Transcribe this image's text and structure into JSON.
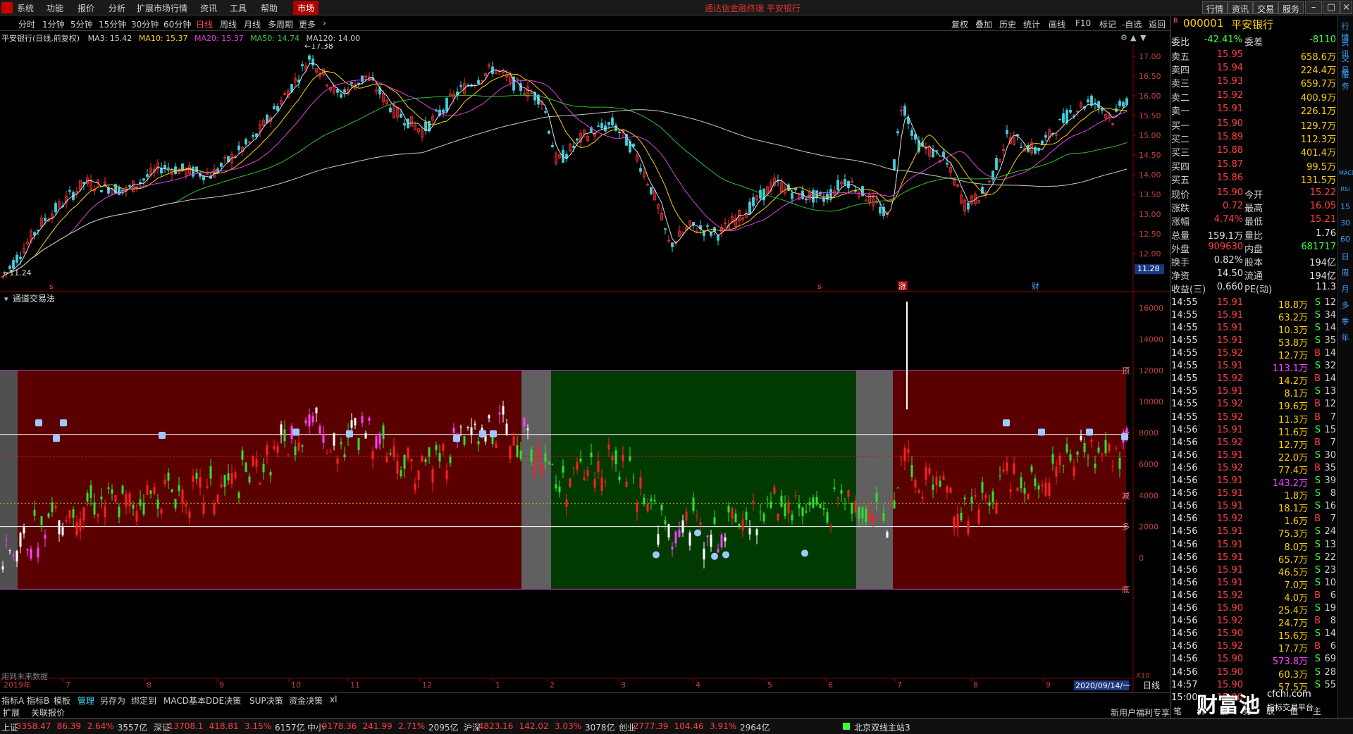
{
  "menu": {
    "items": [
      "系统",
      "功能",
      "报价",
      "分析",
      "扩展市场行情",
      "资讯",
      "工具",
      "帮助"
    ],
    "market": "市场",
    "title": "通达信金融终端  平安银行",
    "buttons": [
      "行情",
      "资讯",
      "交易",
      "服务"
    ]
  },
  "periods": {
    "items": [
      "分时",
      "1分钟",
      "5分钟",
      "15分钟",
      "30分钟",
      "60分钟",
      "日线",
      "周线",
      "月线",
      "多周期",
      "更多"
    ],
    "active": "日线",
    "tools": [
      "复权",
      "叠加",
      "历史",
      "统计",
      "画线",
      "F10",
      "标记",
      "-自选",
      "返回"
    ]
  },
  "info": {
    "stock": "平安银行(日线,前复权)",
    "ma3": "MA3: 15.42",
    "ma10": "MA10: 15.37",
    "ma20": "MA20: 15.37",
    "ma50": "MA50: 14.74",
    "ma120": "MA120: 14.00"
  },
  "chart_data": {
    "type": "candlestick",
    "price_axis": [
      17.0,
      16.5,
      16.0,
      15.5,
      15.0,
      14.5,
      14.0,
      13.5,
      13.0,
      12.5,
      12.0
    ],
    "annotations": {
      "high": "17.38",
      "low": "11.24",
      "current": "11.28",
      "period": "日线"
    },
    "markers": [
      "s",
      "s",
      "涨",
      "财"
    ],
    "months": [
      "2019年",
      "7",
      "8",
      "9",
      "10",
      "11",
      "12",
      "1",
      "2",
      "3",
      "4",
      "5",
      "6",
      "7",
      "8",
      "9"
    ],
    "date_label": "2020/09/14/一",
    "x10": "X10",
    "indicator": {
      "name": "通道交易法",
      "axis": [
        16000,
        14000,
        12000,
        10000,
        8000,
        6000,
        4000,
        2000,
        0
      ],
      "labels": [
        "顶",
        "空",
        "减",
        "多",
        "底"
      ],
      "zones": [
        "red",
        "gray",
        "green",
        "gray",
        "red"
      ],
      "note": "用到未来数据"
    }
  },
  "quote": {
    "code": "000001",
    "name": "平安银行",
    "weibi": [
      "委比",
      "-42.41%",
      "委差",
      "-8110"
    ],
    "sell": [
      [
        "卖五",
        "15.95",
        "658.6万"
      ],
      [
        "卖四",
        "15.94",
        "224.4万"
      ],
      [
        "卖三",
        "15.93",
        "659.7万"
      ],
      [
        "卖二",
        "15.92",
        "400.9万"
      ],
      [
        "卖一",
        "15.91",
        "226.1万"
      ]
    ],
    "buy": [
      [
        "买一",
        "15.90",
        "129.7万"
      ],
      [
        "买二",
        "15.89",
        "112.3万"
      ],
      [
        "买三",
        "15.88",
        "401.4万"
      ],
      [
        "买四",
        "15.87",
        "99.5万"
      ],
      [
        "买五",
        "15.86",
        "131.5万"
      ]
    ],
    "stats": [
      [
        "现价",
        "15.90",
        "今开",
        "15.22"
      ],
      [
        "涨跌",
        "0.72",
        "最高",
        "16.05"
      ],
      [
        "涨幅",
        "4.74%",
        "最低",
        "15.21"
      ],
      [
        "总量",
        "159.1万",
        "量比",
        "1.76"
      ],
      [
        "外盘",
        "909630",
        "内盘",
        "681717"
      ],
      [
        "换手",
        "0.82%",
        "股本",
        "194亿"
      ],
      [
        "净资",
        "14.50",
        "流通",
        "194亿"
      ],
      [
        "收益(三)",
        "0.660",
        "PE(动)",
        "11.3"
      ]
    ],
    "ticks": [
      [
        "14:55",
        "15.91",
        "18.8万",
        "S",
        "12"
      ],
      [
        "14:55",
        "15.91",
        "63.2万",
        "S",
        "34"
      ],
      [
        "14:55",
        "15.91",
        "10.3万",
        "S",
        "14"
      ],
      [
        "14:55",
        "15.91",
        "53.8万",
        "S",
        "35"
      ],
      [
        "14:55",
        "15.92",
        "12.7万",
        "B",
        "14"
      ],
      [
        "14:55",
        "15.91",
        "113.1万",
        "S",
        "32"
      ],
      [
        "14:55",
        "15.92",
        "14.2万",
        "B",
        "14"
      ],
      [
        "14:55",
        "15.91",
        "8.1万",
        "S",
        "13"
      ],
      [
        "14:55",
        "15.92",
        "19.6万",
        "B",
        "12"
      ],
      [
        "14:55",
        "15.92",
        "11.3万",
        "B",
        "7"
      ],
      [
        "14:56",
        "15.91",
        "11.6万",
        "S",
        "15"
      ],
      [
        "14:56",
        "15.92",
        "12.7万",
        "B",
        "7"
      ],
      [
        "14:56",
        "15.91",
        "22.0万",
        "S",
        "30"
      ],
      [
        "14:56",
        "15.92",
        "77.4万",
        "B",
        "35"
      ],
      [
        "14:56",
        "15.91",
        "143.2万",
        "S",
        "39"
      ],
      [
        "14:56",
        "15.91",
        "1.8万",
        "S",
        "8"
      ],
      [
        "14:56",
        "15.91",
        "18.1万",
        "S",
        "16"
      ],
      [
        "14:56",
        "15.92",
        "1.6万",
        "B",
        "7"
      ],
      [
        "14:56",
        "15.91",
        "75.3万",
        "S",
        "24"
      ],
      [
        "14:56",
        "15.91",
        "8.0万",
        "S",
        "13"
      ],
      [
        "14:56",
        "15.91",
        "65.7万",
        "S",
        "22"
      ],
      [
        "14:56",
        "15.91",
        "46.5万",
        "S",
        "23"
      ],
      [
        "14:56",
        "15.91",
        "7.0万",
        "S",
        "10"
      ],
      [
        "14:56",
        "15.92",
        "4.0万",
        "B",
        "6"
      ],
      [
        "14:56",
        "15.90",
        "25.4万",
        "S",
        "19"
      ],
      [
        "14:56",
        "15.92",
        "24.7万",
        "B",
        "8"
      ],
      [
        "14:56",
        "15.90",
        "15.6万",
        "S",
        "14"
      ],
      [
        "14:56",
        "15.92",
        "17.7万",
        "B",
        "6"
      ],
      [
        "14:56",
        "15.90",
        "573.8万",
        "S",
        "69"
      ],
      [
        "14:56",
        "15.90",
        "60.3万",
        "S",
        "28"
      ],
      [
        "14:57",
        "15.90",
        "57.5万",
        "S",
        "55"
      ],
      [
        "15:00",
        "15.90",
        "",
        "",
        ""
      ]
    ],
    "bottom_links": [
      "笔",
      "价",
      "细",
      "势",
      "联",
      "值",
      "主"
    ]
  },
  "vtabs": [
    "行情",
    "资讯",
    "交易",
    "服务",
    "MACD",
    "RSI",
    "15",
    "30",
    "60",
    "日",
    "周",
    "月",
    "多",
    "季",
    "年"
  ],
  "bottom_tabs": [
    "指标A",
    "指标B",
    "模板",
    "管理",
    "另存为",
    "绑定到",
    "MACD基本",
    "DDE决策",
    "SUP决策",
    "资金决策",
    "xl"
  ],
  "bottom2": [
    "扩展",
    "关联报价"
  ],
  "promo": "新用户福利专享",
  "status": [
    [
      "上证",
      "3358.47",
      "86.39",
      "2.64%",
      "3557亿"
    ],
    [
      "深证",
      "13708.1",
      "418.81",
      "3.15%",
      "6157亿"
    ],
    [
      "中小",
      "9178.36",
      "241.99",
      "2.71%",
      "2095亿"
    ],
    [
      "沪深",
      "4823.16",
      "142.02",
      "3.03%",
      "3078亿"
    ],
    [
      "创业",
      "2777.39",
      "104.46",
      "3.91%",
      "2964亿"
    ]
  ],
  "server": "北京双线主站3",
  "watermark": {
    "title": "财富池",
    "url": "cfchi.com",
    "sub": "指标交易平台"
  }
}
